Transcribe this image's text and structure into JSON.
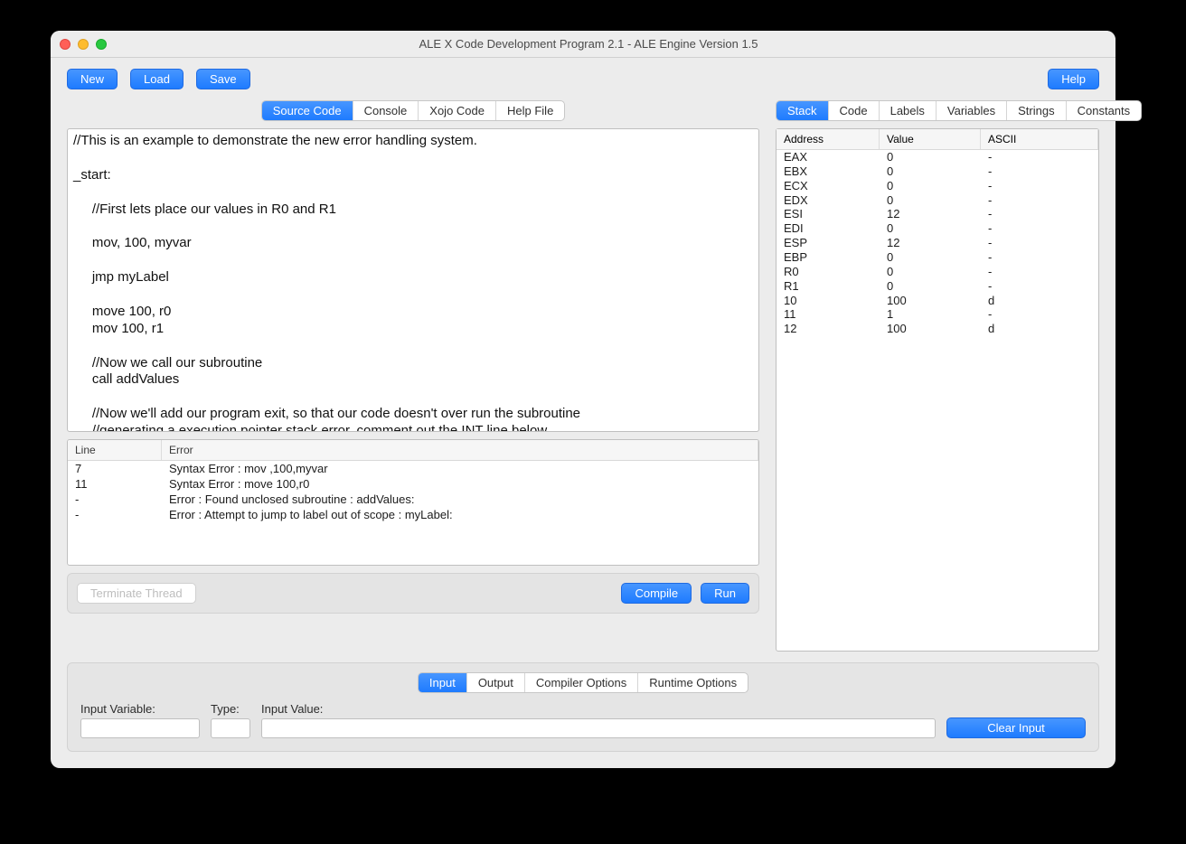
{
  "window": {
    "title": "ALE X Code Development Program 2.1 - ALE Engine Version 1.5"
  },
  "toolbar": {
    "new": "New",
    "load": "Load",
    "save": "Save",
    "help": "Help"
  },
  "left_tabs": [
    "Source Code",
    "Console",
    "Xojo Code",
    "Help File"
  ],
  "left_tab_selected": 0,
  "right_tabs": [
    "Stack",
    "Code",
    "Labels",
    "Variables",
    "Strings",
    "Constants"
  ],
  "right_tab_selected": 0,
  "source_code": "//This is an example to demonstrate the new error handling system.\n\n_start:\n\n     //First lets place our values in R0 and R1\n\n     mov, 100, myvar\n\n     jmp myLabel\n\n     move 100, r0\n     mov 100, r1\n\n     //Now we call our subroutine\n     call addValues\n\n     //Now we'll add our program exit, so that our code doesn't over run the subroutine\n     //generating a execution pointer stack error, comment out the INT line below\n     //if you wish to see that.",
  "errors": {
    "columns": [
      "Line",
      "Error"
    ],
    "rows": [
      {
        "line": "7",
        "error": "Syntax Error : mov ,100,myvar"
      },
      {
        "line": "11",
        "error": "Syntax Error : move 100,r0"
      },
      {
        "line": "-",
        "error": "Error : Found unclosed subroutine : addValues:"
      },
      {
        "line": "-",
        "error": "Error : Attempt to jump to label out of scope : myLabel:"
      }
    ]
  },
  "actions": {
    "terminate": "Terminate Thread",
    "compile": "Compile",
    "run": "Run"
  },
  "stack": {
    "columns": [
      "Address",
      "Value",
      "ASCII"
    ],
    "rows": [
      {
        "address": "EAX",
        "value": "0",
        "ascii": "-"
      },
      {
        "address": "EBX",
        "value": "0",
        "ascii": "-"
      },
      {
        "address": "ECX",
        "value": "0",
        "ascii": "-"
      },
      {
        "address": "EDX",
        "value": "0",
        "ascii": "-"
      },
      {
        "address": "ESI",
        "value": "12",
        "ascii": "-"
      },
      {
        "address": "EDI",
        "value": "0",
        "ascii": "-"
      },
      {
        "address": "ESP",
        "value": "12",
        "ascii": "-"
      },
      {
        "address": "EBP",
        "value": "0",
        "ascii": "-"
      },
      {
        "address": "R0",
        "value": "0",
        "ascii": "-"
      },
      {
        "address": "R1",
        "value": "0",
        "ascii": "-"
      },
      {
        "address": "10",
        "value": "100",
        "ascii": "d"
      },
      {
        "address": "11",
        "value": "1",
        "ascii": "-"
      },
      {
        "address": "12",
        "value": "100",
        "ascii": "d"
      }
    ]
  },
  "bottom_tabs": [
    "Input",
    "Output",
    "Compiler Options",
    "Runtime Options"
  ],
  "bottom_tab_selected": 0,
  "input_form": {
    "var_label": "Input Variable:",
    "type_label": "Type:",
    "value_label": "Input Value:",
    "var_value": "",
    "type_value": "",
    "value_value": "",
    "clear": "Clear Input"
  }
}
